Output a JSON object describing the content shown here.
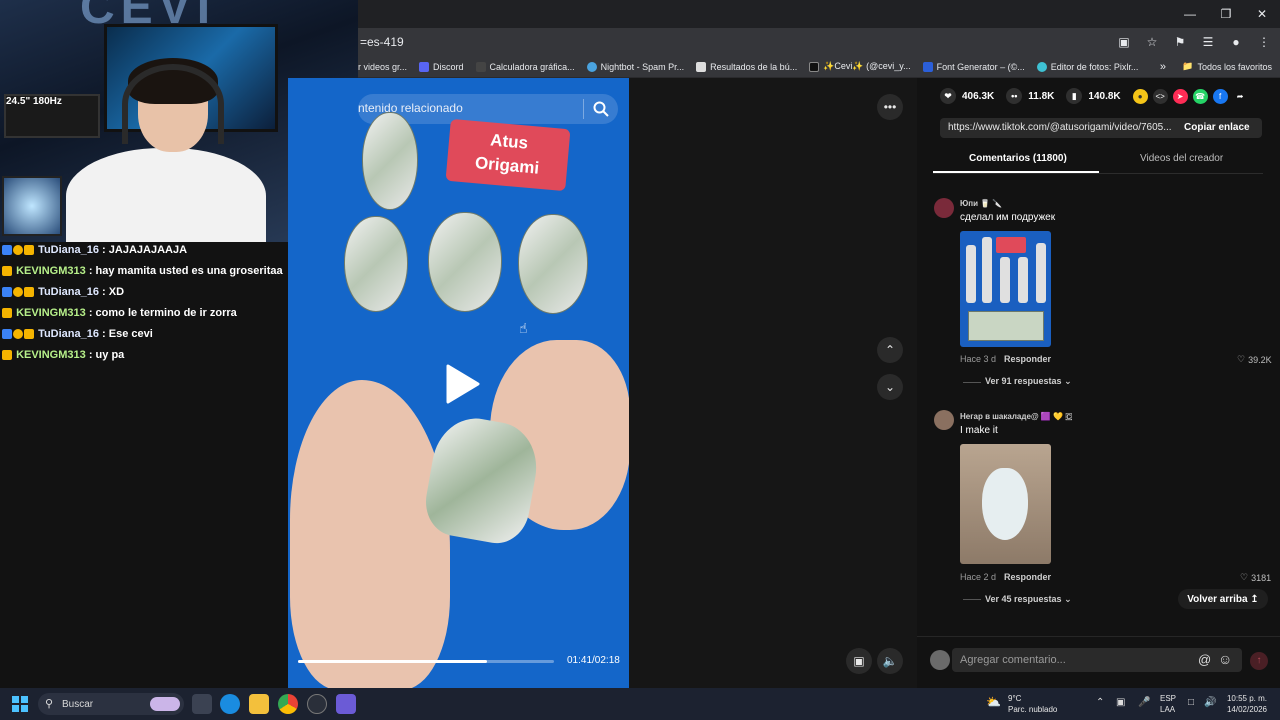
{
  "browser": {
    "url_fragment": "=es-419",
    "bookmarks": [
      {
        "label": "r videos gr..."
      },
      {
        "label": "Discord"
      },
      {
        "label": "Calculadora gráfica..."
      },
      {
        "label": "Nightbot - Spam Pr..."
      },
      {
        "label": "Resultados de la bú..."
      },
      {
        "label": "✨Cevi✨ (@cevi_y..."
      },
      {
        "label": "Font Generator – (©..."
      },
      {
        "label": "Editor de fotos: Pixlr..."
      }
    ],
    "all_bookmarks": "Todos los favoritos"
  },
  "stream": {
    "webcam_hz": "24.5\" 180Hz",
    "chat": [
      {
        "user": "TuDiana_16",
        "sep": " : ",
        "msg": "JAJAJAJAAJA"
      },
      {
        "user": "KEVINGM313",
        "sep": " : ",
        "msg": "hay mamita usted es una groseritaa"
      },
      {
        "user": "TuDiana_16",
        "sep": " : ",
        "msg": "XD"
      },
      {
        "user": "KEVINGM313",
        "sep": " : ",
        "msg": "como le termino de ir zorra"
      },
      {
        "user": "TuDiana_16",
        "sep": " : ",
        "msg": "Ese cevi"
      },
      {
        "user": "KEVINGM313",
        "sep": " : ",
        "msg": "uy pa"
      }
    ]
  },
  "video": {
    "search_text": "ntenido relacionado",
    "sign_text_1": "Atus",
    "sign_text_2": "Origami",
    "time": "01:41/02:18",
    "progress": 0.74
  },
  "panel": {
    "likes": "406.3K",
    "comments": "11.8K",
    "saves": "140.8K",
    "link": "https://www.tiktok.com/@atusorigami/video/7605...",
    "copy_label": "Copiar enlace",
    "tab_comments": "Comentarios (11800)",
    "tab_videos": "Videos del creador",
    "comment_list": [
      {
        "user": "Юпи 🥛 🔪",
        "text": "сделал им подружек",
        "meta": "Hace 3 d",
        "reply": "Responder",
        "likes": "39.2K",
        "see_more": "Ver 91 respuestas"
      },
      {
        "user": "Негар в шакаладе@ 🟪 💛 🇨",
        "text": "I make it",
        "meta": "Hace 2 d",
        "reply": "Responder",
        "likes": "3181",
        "see_more": "Ver 45 respuestas"
      }
    ],
    "back_top": "Volver arriba",
    "comment_placeholder": "Agregar comentario..."
  },
  "taskbar": {
    "search": "Buscar",
    "weather_temp": "9°C",
    "weather_desc": "Parc. nublado",
    "lang_1": "ESP",
    "lang_2": "LAA",
    "time": "10:55 p. m.",
    "date": "14/02/2026"
  },
  "colors": {
    "video_bg": "#1466c9",
    "accent_red": "#fe2c55",
    "chat_user_1": "#dfe8ff",
    "chat_user_2": "#b7f08a"
  }
}
